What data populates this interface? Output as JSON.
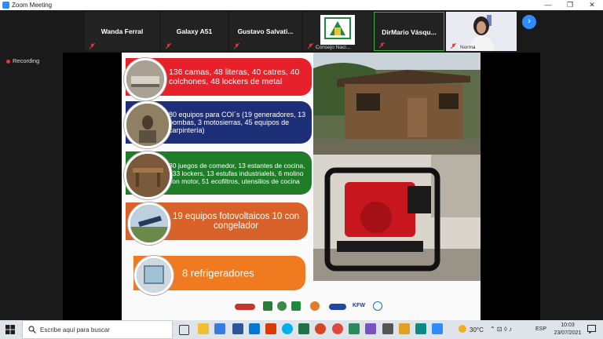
{
  "window": {
    "title": "Zoom Meeting"
  },
  "participants": [
    {
      "name": "Wanda Ferral"
    },
    {
      "name": "Galaxy A51"
    },
    {
      "name": "Gustavo  Salvati..."
    },
    {
      "name": "",
      "caption": "Consejo Naci..."
    },
    {
      "name": "DirMario  Vásqu..."
    },
    {
      "name": "",
      "caption": "Norma"
    }
  ],
  "status": {
    "recording": "Recording"
  },
  "slide": {
    "items": [
      {
        "text": "136 camas, 48 literas, 40 catres, 40 colchones, 48 lockers de metal",
        "color": "#e8202a"
      },
      {
        "text": "80 equipos para COI´s (19 generadores, 13 bombas, 3 motosierras, 45 equipos de carpintería)",
        "color": "#1e2f7a"
      },
      {
        "text": "30 juegos de comedor, 13 estantes de cocina, 133 lockers, 13 estufas industrialels, 6 molino con motor, 51 ecofiltros,  utensilios de cocina",
        "color": "#1f7d2a"
      },
      {
        "text": "19 equipos fotovoltaicos 10 con congelador",
        "color": "#d9622b"
      },
      {
        "text": "8 refrigeradores",
        "color": "#f07a20"
      }
    ],
    "logo_labels": [
      "KFW"
    ]
  },
  "taskbar": {
    "search_placeholder": "Escribe aquí para buscar",
    "weather": "30°C",
    "language": "ESP",
    "time": "10:03",
    "date": "23/07/2021"
  },
  "colors": {
    "zoom_blue": "#2d8cff",
    "mute_red": "#e03a3a"
  }
}
